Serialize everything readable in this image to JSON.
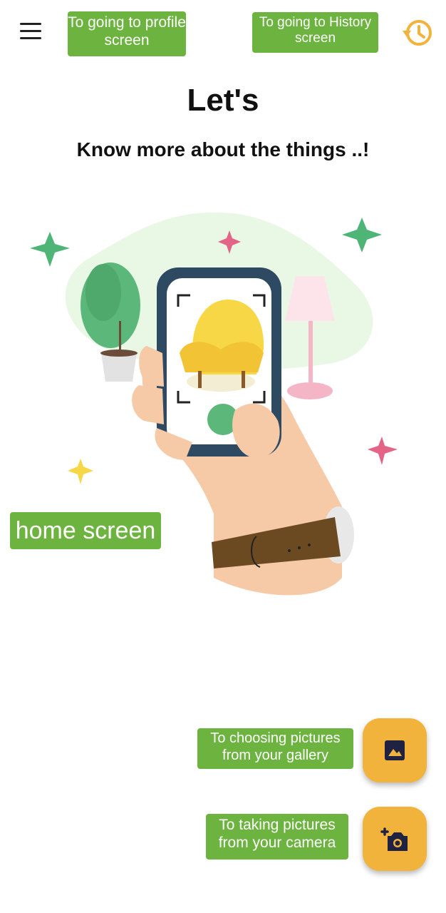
{
  "header": {
    "menu_icon": "hamburger-menu-icon",
    "history_icon": "history-icon",
    "profile_annotation": "To going to profile screen",
    "history_annotation": "To going to History screen"
  },
  "main": {
    "title": "Let's",
    "subtitle": "Know more about the things ..!",
    "screen_annotation": "home screen"
  },
  "actions": {
    "gallery_annotation": "To choosing pictures from your gallery",
    "camera_annotation": "To taking pictures from your camera",
    "gallery_icon": "image-icon",
    "camera_icon": "add-camera-icon"
  },
  "colors": {
    "annotation_bg": "#6cb33f",
    "fab_bg": "#f2b33d",
    "history_icon": "#f2b33d"
  }
}
